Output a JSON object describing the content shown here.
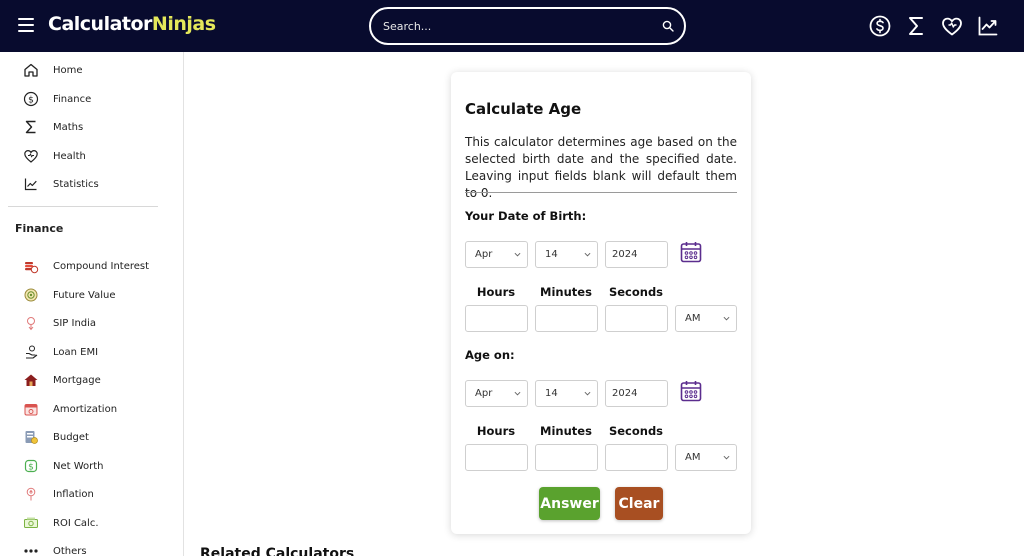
{
  "header": {
    "logo_main": "Calculator",
    "logo_accent": "Ninjas",
    "search_placeholder": "Search...",
    "icons": [
      "menu-icon",
      "search-icon",
      "dollar-icon",
      "sigma-icon",
      "heart-icon",
      "chart-line-icon"
    ]
  },
  "sidebar": {
    "main_items": [
      {
        "label": "Home",
        "icon": "home-icon"
      },
      {
        "label": "Finance",
        "icon": "dollar-icon"
      },
      {
        "label": "Maths",
        "icon": "sigma-icon"
      },
      {
        "label": "Health",
        "icon": "heart-icon"
      },
      {
        "label": "Statistics",
        "icon": "chart-line-icon"
      }
    ],
    "section_heading": "Finance",
    "finance_items": [
      {
        "label": "Compound Interest",
        "icon": "coins-icon"
      },
      {
        "label": "Future Value",
        "icon": "target-icon"
      },
      {
        "label": "SIP India",
        "icon": "rupee-icon"
      },
      {
        "label": "Loan EMI",
        "icon": "hand-coin-icon"
      },
      {
        "label": "Mortgage",
        "icon": "house-icon"
      },
      {
        "label": "Amortization",
        "icon": "calendar-icon"
      },
      {
        "label": "Budget",
        "icon": "budget-icon"
      },
      {
        "label": "Net Worth",
        "icon": "dollar-badge-icon"
      },
      {
        "label": "Inflation",
        "icon": "inflation-icon"
      },
      {
        "label": "ROI Calc.",
        "icon": "cash-icon"
      },
      {
        "label": "Others",
        "icon": "more-dots-icon"
      }
    ]
  },
  "calculator": {
    "title": "Calculate Age",
    "description": "This calculator determines age based on the selected birth date and the specified date. Leaving input fields blank will default them to 0.",
    "birth_label": "Your Date of Birth:",
    "birth": {
      "month": "Apr",
      "day": "14",
      "year": "2024",
      "hours": "",
      "minutes": "",
      "seconds": "",
      "ampm": "AM"
    },
    "age_on_label": "Age on:",
    "age_on": {
      "month": "Apr",
      "day": "14",
      "year": "2024",
      "hours": "",
      "minutes": "",
      "seconds": "",
      "ampm": "AM"
    },
    "col_hours": "Hours",
    "col_minutes": "Minutes",
    "col_seconds": "Seconds",
    "answer_label": "Answer",
    "clear_label": "Clear"
  },
  "related_heading": "Related Calculators",
  "colors": {
    "header_bg": "#080b2e",
    "logo_accent": "#e4e85a",
    "answer_button": "#5aa22e",
    "clear_button": "#a84f22",
    "calendar_icon": "#5b2d8e"
  }
}
